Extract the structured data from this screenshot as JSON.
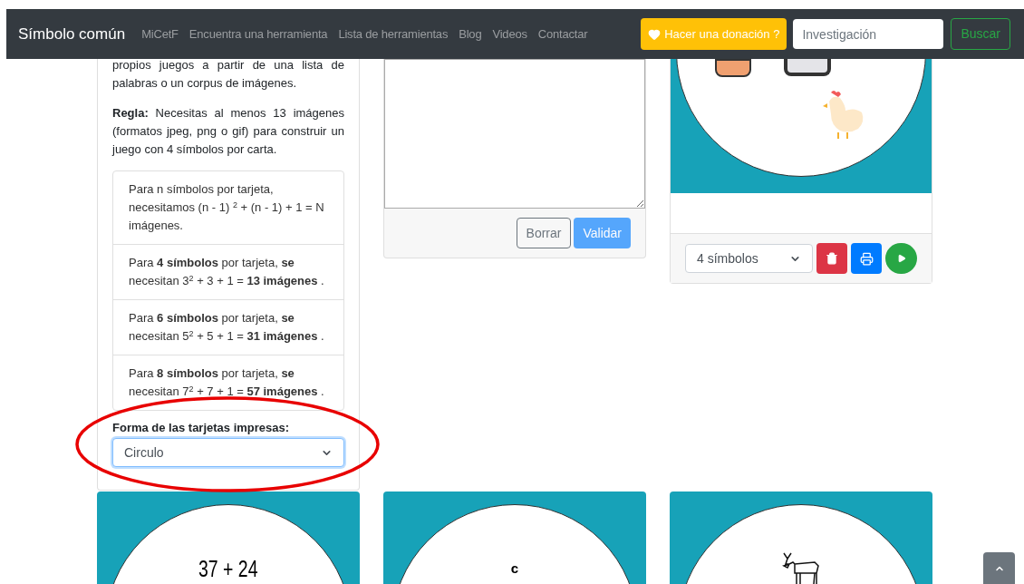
{
  "navbar": {
    "brand": "Símbolo común",
    "links": [
      "MiCetF",
      "Encuentra una herramienta",
      "Lista de herramientas",
      "Blog",
      "Videos",
      "Contactar"
    ],
    "donate_button": "Hacer una donación ?",
    "search": {
      "placeholder": "Investigación"
    },
    "search_button": "Buscar"
  },
  "info_panel": {
    "paragraphs": [
      "propios juegos a partir de una lista de palabras o un corpus de imágenes.",
      "**Regla:** Necesitas al menos 13 imágenes (formatos jpeg, png o gif) para construir un juego con 4 símbolos por carta."
    ],
    "rules": [
      "Para n símbolos por tarjeta, necesitamos (n - 1) $^{2}$ + (n - 1) + 1 = N imágenes.",
      "Para **4 símbolos** por tarjeta, **se** necesitan 3$^{2}$ + 3 + 1 = **13 imágenes** .",
      "Para **6 símbolos** por tarjeta, **se** necesitan 5$^{2}$ + 5 + 1 = **31 imágenes** .",
      "Para **8 símbolos** por tarjeta, **se** necesitan 7$^{2}$ + 7 + 1 = **57 imágenes** ."
    ],
    "shape_label": "Forma de las tarjetas impresas:",
    "shape_select": "Circulo",
    "highlighted": true
  },
  "word_panel": {
    "buttons": [
      {
        "label": "Borrar",
        "kind": "outline",
        "disabled": false
      },
      {
        "label": "Validar",
        "kind": "primary",
        "disabled": true
      }
    ]
  },
  "preview_card": {
    "symbols_select": "4 símbolos"
  },
  "cards": [
    {
      "kind": "text",
      "text": "37 + 24"
    },
    {
      "kind": "letter",
      "text": "c"
    },
    {
      "kind": "donkey"
    }
  ]
}
